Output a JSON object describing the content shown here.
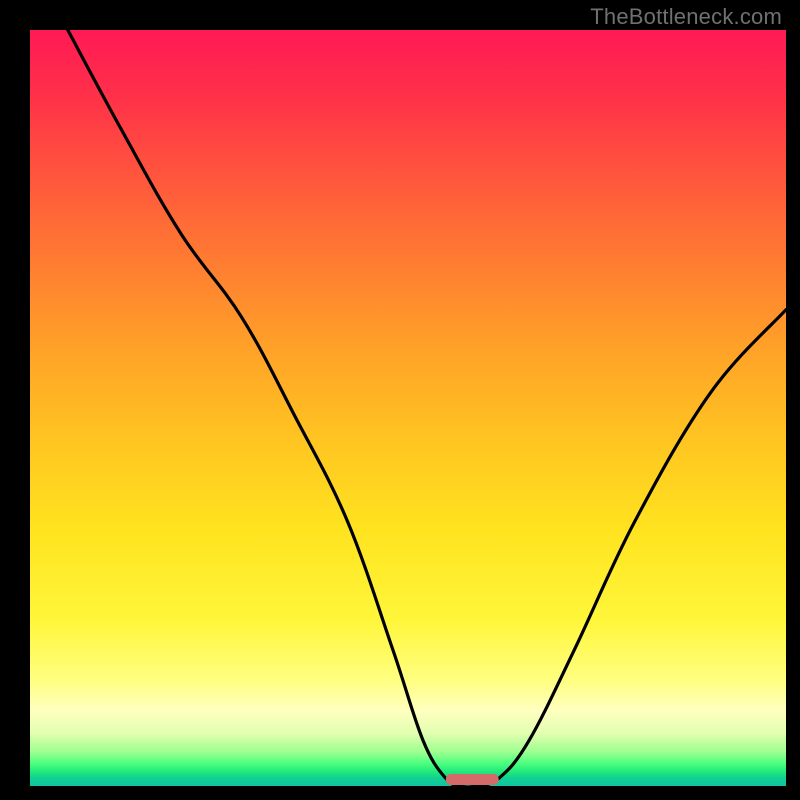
{
  "watermark": "TheBottleneck.com",
  "chart_data": {
    "type": "line",
    "title": "",
    "xlabel": "",
    "ylabel": "",
    "xlim": [
      0,
      100
    ],
    "ylim": [
      0,
      100
    ],
    "grid": false,
    "series": [
      {
        "name": "bottleneck-curve",
        "x": [
          5,
          12,
          20,
          28,
          35,
          42,
          48,
          52,
          55,
          57,
          59,
          62,
          66,
          72,
          80,
          90,
          100
        ],
        "values": [
          100,
          87,
          73,
          62,
          49,
          35,
          18,
          6,
          1,
          0,
          0,
          1,
          6,
          18,
          35,
          52,
          63
        ]
      }
    ],
    "marker": {
      "x_start": 55,
      "x_end": 62,
      "y": 0
    },
    "background_gradient": {
      "top": "#ff1a55",
      "mid": "#ffe31f",
      "bottom": "#12c39f"
    }
  }
}
